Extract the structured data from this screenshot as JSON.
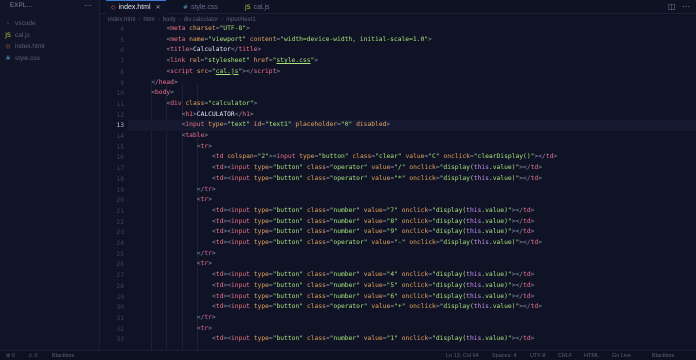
{
  "sidebar": {
    "title": "EXPL...",
    "more_icon": "ellipsis",
    "items": [
      {
        "label": "vscode",
        "icon": "chevron-right-icon",
        "color": "#5b6078"
      },
      {
        "label": "cal.js",
        "icon": "js-file-icon",
        "color": "#cbcb41"
      },
      {
        "label": "index.html",
        "icon": "html-file-icon",
        "color": "#e4794b"
      },
      {
        "label": "style.css",
        "icon": "css-file-icon",
        "color": "#519aba"
      }
    ]
  },
  "tabs": [
    {
      "label": "index.html",
      "active": true
    },
    {
      "label": "style.css",
      "active": false
    },
    {
      "label": "cal.js",
      "active": false
    }
  ],
  "breadcrumb": [
    "index.html",
    "html",
    "body",
    "div.calculator",
    "input#text1"
  ],
  "editor": {
    "current_line": 13,
    "lines": [
      {
        "n": "4",
        "indent": 8,
        "html": "<span class='t-br'>&lt;</span><span class='t-tag'>meta</span> <span class='t-attr'>charset</span><span class='t-br'>=</span><span class='t-str'>\"UTF-8\"</span><span class='t-br'>&gt;</span>"
      },
      {
        "n": "5",
        "indent": 8,
        "html": "<span class='t-br'>&lt;</span><span class='t-tag'>meta</span> <span class='t-attr'>name</span><span class='t-br'>=</span><span class='t-str'>\"viewport\"</span> <span class='t-attr'>content</span><span class='t-br'>=</span><span class='t-str'>\"width=device-width, initial-scale=1.0\"</span><span class='t-br'>&gt;</span>"
      },
      {
        "n": "6",
        "indent": 8,
        "html": "<span class='t-br'>&lt;</span><span class='t-tag'>title</span><span class='t-br'>&gt;</span><span class='t-text'>Calculator</span><span class='t-br'>&lt;/</span><span class='t-tag'>title</span><span class='t-br'>&gt;</span>"
      },
      {
        "n": "7",
        "indent": 8,
        "html": "<span class='t-br'>&lt;</span><span class='t-tag'>link</span> <span class='t-attr'>rel</span><span class='t-br'>=</span><span class='t-str'>\"stylesheet\"</span> <span class='t-attr'>href</span><span class='t-br'>=</span><span class='t-str'>\"<u>style.css</u>\"</span><span class='t-br'>&gt;</span>"
      },
      {
        "n": "8",
        "indent": 8,
        "html": "<span class='t-br'>&lt;</span><span class='t-tag'>script</span> <span class='t-attr'>src</span><span class='t-br'>=</span><span class='t-str'>\"<u>cal.js</u>\"</span><span class='t-br'>&gt;&lt;/</span><span class='t-tag'>script</span><span class='t-br'>&gt;</span>"
      },
      {
        "n": "9",
        "indent": 4,
        "html": "<span class='t-br'>&lt;/</span><span class='t-tag'>head</span><span class='t-br'>&gt;</span>"
      },
      {
        "n": "10",
        "indent": 4,
        "html": "<span class='t-br'>&lt;</span><span class='t-tag'>body</span><span class='t-br'>&gt;</span>"
      },
      {
        "n": "11",
        "indent": 8,
        "html": "<span class='t-br'>&lt;</span><span class='t-tag'>div</span> <span class='t-attr'>class</span><span class='t-br'>=</span><span class='t-str'>\"calculator\"</span><span class='t-br'>&gt;</span>"
      },
      {
        "n": "12",
        "indent": 12,
        "html": "<span class='t-br'>&lt;</span><span class='t-tag'>h1</span><span class='t-br'>&gt;</span><span class='t-text'>CALCULATOR</span><span class='t-br'>&lt;/</span><span class='t-tag'>h1</span><span class='t-br'>&gt;</span>"
      },
      {
        "n": "13",
        "indent": 12,
        "html": "<span class='t-br'>&lt;</span><span class='t-tag'>input</span> <span class='t-attr'>type</span><span class='t-br'>=</span><span class='t-str'>\"text\"</span> <span class='t-attr'>id</span><span class='t-br'>=</span><span class='t-str'>\"text1\"</span> <span class='t-attr'>placeholder</span><span class='t-br'>=</span><span class='t-str'>\"0\"</span> <span class='t-attr'>disabled</span><span class='t-br'>&gt;</span>"
      },
      {
        "n": "14",
        "indent": 12,
        "html": "<span class='t-br'>&lt;</span><span class='t-tag'>table</span><span class='t-br'>&gt;</span>"
      },
      {
        "n": "15",
        "indent": 16,
        "html": "<span class='t-br'>&lt;</span><span class='t-tag'>tr</span><span class='t-br'>&gt;</span>"
      },
      {
        "n": "16",
        "indent": 20,
        "html": "<span class='t-br'>&lt;</span><span class='t-tag'>td</span> <span class='t-attr'>colspan</span><span class='t-br'>=</span><span class='t-str'>\"2\"</span><span class='t-br'>&gt;&lt;</span><span class='t-tag'>input</span> <span class='t-attr'>type</span><span class='t-br'>=</span><span class='t-str'>\"button\"</span> <span class='t-attr'>class</span><span class='t-br'>=</span><span class='t-str'>\"clear\"</span> <span class='t-attr'>value</span><span class='t-br'>=</span><span class='t-str'>\"C\"</span> <span class='t-attr'>onclick</span><span class='t-br'>=</span><span class='t-str'>\"clearDisplay()\"</span><span class='t-br'>&gt;&lt;/</span><span class='t-tag'>td</span><span class='t-br'>&gt;</span>"
      },
      {
        "n": "17",
        "indent": 20,
        "html": "<span class='t-br'>&lt;</span><span class='t-tag'>td</span><span class='t-br'>&gt;&lt;</span><span class='t-tag'>input</span> <span class='t-attr'>type</span><span class='t-br'>=</span><span class='t-str'>\"button\"</span> <span class='t-attr'>class</span><span class='t-br'>=</span><span class='t-str'>\"operator\"</span> <span class='t-attr'>value</span><span class='t-br'>=</span><span class='t-str'>\"/\"</span> <span class='t-attr'>onclick</span><span class='t-br'>=</span><span class='t-str'>\"display(<span class='t-kw'>this</span>.value)\"</span><span class='t-br'>&gt;&lt;/</span><span class='t-tag'>td</span><span class='t-br'>&gt;</span>"
      },
      {
        "n": "18",
        "indent": 20,
        "html": "<span class='t-br'>&lt;</span><span class='t-tag'>td</span><span class='t-br'>&gt;&lt;</span><span class='t-tag'>input</span> <span class='t-attr'>type</span><span class='t-br'>=</span><span class='t-str'>\"button\"</span> <span class='t-attr'>class</span><span class='t-br'>=</span><span class='t-str'>\"operator\"</span> <span class='t-attr'>value</span><span class='t-br'>=</span><span class='t-str'>\"*\"</span> <span class='t-attr'>onclick</span><span class='t-br'>=</span><span class='t-str'>\"display(<span class='t-kw'>this</span>.value)\"</span><span class='t-br'>&gt;&lt;/</span><span class='t-tag'>td</span><span class='t-br'>&gt;</span>"
      },
      {
        "n": "19",
        "indent": 16,
        "html": "<span class='t-br'>&lt;/</span><span class='t-tag'>tr</span><span class='t-br'>&gt;</span>"
      },
      {
        "n": "20",
        "indent": 16,
        "html": "<span class='t-br'>&lt;</span><span class='t-tag'>tr</span><span class='t-br'>&gt;</span>"
      },
      {
        "n": "21",
        "indent": 20,
        "html": "<span class='t-br'>&lt;</span><span class='t-tag'>td</span><span class='t-br'>&gt;&lt;</span><span class='t-tag'>input</span> <span class='t-attr'>type</span><span class='t-br'>=</span><span class='t-str'>\"button\"</span> <span class='t-attr'>class</span><span class='t-br'>=</span><span class='t-str'>\"number\"</span> <span class='t-attr'>value</span><span class='t-br'>=</span><span class='t-str'>\"7\"</span> <span class='t-attr'>onclick</span><span class='t-br'>=</span><span class='t-str'>\"display(<span class='t-kw'>this</span>.value)\"</span><span class='t-br'>&gt;&lt;/</span><span class='t-tag'>td</span><span class='t-br'>&gt;</span>"
      },
      {
        "n": "22",
        "indent": 20,
        "html": "<span class='t-br'>&lt;</span><span class='t-tag'>td</span><span class='t-br'>&gt;&lt;</span><span class='t-tag'>input</span> <span class='t-attr'>type</span><span class='t-br'>=</span><span class='t-str'>\"button\"</span> <span class='t-attr'>class</span><span class='t-br'>=</span><span class='t-str'>\"number\"</span> <span class='t-attr'>value</span><span class='t-br'>=</span><span class='t-str'>\"8\"</span> <span class='t-attr'>onclick</span><span class='t-br'>=</span><span class='t-str'>\"display(<span class='t-kw'>this</span>.value)\"</span><span class='t-br'>&gt;&lt;/</span><span class='t-tag'>td</span><span class='t-br'>&gt;</span>"
      },
      {
        "n": "23",
        "indent": 20,
        "html": "<span class='t-br'>&lt;</span><span class='t-tag'>td</span><span class='t-br'>&gt;&lt;</span><span class='t-tag'>input</span> <span class='t-attr'>type</span><span class='t-br'>=</span><span class='t-str'>\"button\"</span> <span class='t-attr'>class</span><span class='t-br'>=</span><span class='t-str'>\"number\"</span> <span class='t-attr'>value</span><span class='t-br'>=</span><span class='t-str'>\"9\"</span> <span class='t-attr'>onclick</span><span class='t-br'>=</span><span class='t-str'>\"display(<span class='t-kw'>this</span>.value)\"</span><span class='t-br'>&gt;&lt;/</span><span class='t-tag'>td</span><span class='t-br'>&gt;</span>"
      },
      {
        "n": "24",
        "indent": 20,
        "html": "<span class='t-br'>&lt;</span><span class='t-tag'>td</span><span class='t-br'>&gt;&lt;</span><span class='t-tag'>input</span> <span class='t-attr'>type</span><span class='t-br'>=</span><span class='t-str'>\"button\"</span> <span class='t-attr'>class</span><span class='t-br'>=</span><span class='t-str'>\"operator\"</span> <span class='t-attr'>value</span><span class='t-br'>=</span><span class='t-str'>\"-\"</span> <span class='t-attr'>onclick</span><span class='t-br'>=</span><span class='t-str'>\"display(<span class='t-kw'>this</span>.value)\"</span><span class='t-br'>&gt;&lt;/</span><span class='t-tag'>td</span><span class='t-br'>&gt;</span>"
      },
      {
        "n": "25",
        "indent": 16,
        "html": "<span class='t-br'>&lt;/</span><span class='t-tag'>tr</span><span class='t-br'>&gt;</span>"
      },
      {
        "n": "26",
        "indent": 16,
        "html": "<span class='t-br'>&lt;</span><span class='t-tag'>tr</span><span class='t-br'>&gt;</span>"
      },
      {
        "n": "27",
        "indent": 20,
        "html": "<span class='t-br'>&lt;</span><span class='t-tag'>td</span><span class='t-br'>&gt;&lt;</span><span class='t-tag'>input</span> <span class='t-attr'>type</span><span class='t-br'>=</span><span class='t-str'>\"button\"</span> <span class='t-attr'>class</span><span class='t-br'>=</span><span class='t-str'>\"number\"</span> <span class='t-attr'>value</span><span class='t-br'>=</span><span class='t-str'>\"4\"</span> <span class='t-attr'>onclick</span><span class='t-br'>=</span><span class='t-str'>\"display(<span class='t-kw'>this</span>.value)\"</span><span class='t-br'>&gt;&lt;/</span><span class='t-tag'>td</span><span class='t-br'>&gt;</span>"
      },
      {
        "n": "28",
        "indent": 20,
        "html": "<span class='t-br'>&lt;</span><span class='t-tag'>td</span><span class='t-br'>&gt;&lt;</span><span class='t-tag'>input</span> <span class='t-attr'>type</span><span class='t-br'>=</span><span class='t-str'>\"button\"</span> <span class='t-attr'>class</span><span class='t-br'>=</span><span class='t-str'>\"number\"</span> <span class='t-attr'>value</span><span class='t-br'>=</span><span class='t-str'>\"5\"</span> <span class='t-attr'>onclick</span><span class='t-br'>=</span><span class='t-str'>\"display(<span class='t-kw'>this</span>.value)\"</span><span class='t-br'>&gt;&lt;/</span><span class='t-tag'>td</span><span class='t-br'>&gt;</span>"
      },
      {
        "n": "29",
        "indent": 20,
        "html": "<span class='t-br'>&lt;</span><span class='t-tag'>td</span><span class='t-br'>&gt;&lt;</span><span class='t-tag'>input</span> <span class='t-attr'>type</span><span class='t-br'>=</span><span class='t-str'>\"button\"</span> <span class='t-attr'>class</span><span class='t-br'>=</span><span class='t-str'>\"number\"</span> <span class='t-attr'>value</span><span class='t-br'>=</span><span class='t-str'>\"6\"</span> <span class='t-attr'>onclick</span><span class='t-br'>=</span><span class='t-str'>\"display(<span class='t-kw'>this</span>.value)\"</span><span class='t-br'>&gt;&lt;/</span><span class='t-tag'>td</span><span class='t-br'>&gt;</span>"
      },
      {
        "n": "30",
        "indent": 20,
        "html": "<span class='t-br'>&lt;</span><span class='t-tag'>td</span><span class='t-br'>&gt;&lt;</span><span class='t-tag'>input</span> <span class='t-attr'>type</span><span class='t-br'>=</span><span class='t-str'>\"button\"</span> <span class='t-attr'>class</span><span class='t-br'>=</span><span class='t-str'>\"operator\"</span> <span class='t-attr'>value</span><span class='t-br'>=</span><span class='t-str'>\"+\"</span> <span class='t-attr'>onclick</span><span class='t-br'>=</span><span class='t-str'>\"display(<span class='t-kw'>this</span>.value)\"</span><span class='t-br'>&gt;&lt;/</span><span class='t-tag'>td</span><span class='t-br'>&gt;</span>"
      },
      {
        "n": "31",
        "indent": 16,
        "html": "<span class='t-br'>&lt;/</span><span class='t-tag'>tr</span><span class='t-br'>&gt;</span>"
      },
      {
        "n": "32",
        "indent": 16,
        "html": "<span class='t-br'>&lt;</span><span class='t-tag'>tr</span><span class='t-br'>&gt;</span>"
      },
      {
        "n": "33",
        "indent": 20,
        "html": "<span class='t-br'>&lt;</span><span class='t-tag'>td</span><span class='t-br'>&gt;&lt;</span><span class='t-tag'>input</span> <span class='t-attr'>type</span><span class='t-br'>=</span><span class='t-str'>\"button\"</span> <span class='t-attr'>class</span><span class='t-br'>=</span><span class='t-str'>\"number\"</span> <span class='t-attr'>value</span><span class='t-br'>=</span><span class='t-str'>\"1\"</span> <span class='t-attr'>onclick</span><span class='t-br'>=</span><span class='t-str'>\"display(<span class='t-kw'>this</span>.value)\"</span><span class='t-br'>&gt;&lt;/</span><span class='t-tag'>td</span><span class='t-br'>&gt;</span>"
      }
    ]
  },
  "statusbar": {
    "left": [
      "⊗ 0",
      "⚠ 0",
      "Blackbox"
    ],
    "right": [
      "Ln 13, Col 64",
      "Spaces: 4",
      "UTF-8",
      "CRLF",
      "HTML",
      "Go Live",
      "Blackbox"
    ]
  },
  "colors": {
    "background": "#101326",
    "tag": "#f0718b",
    "attribute": "#e7a35a",
    "string": "#a6e27a",
    "keyword": "#c792ea",
    "accent": "#3b7bd6"
  }
}
